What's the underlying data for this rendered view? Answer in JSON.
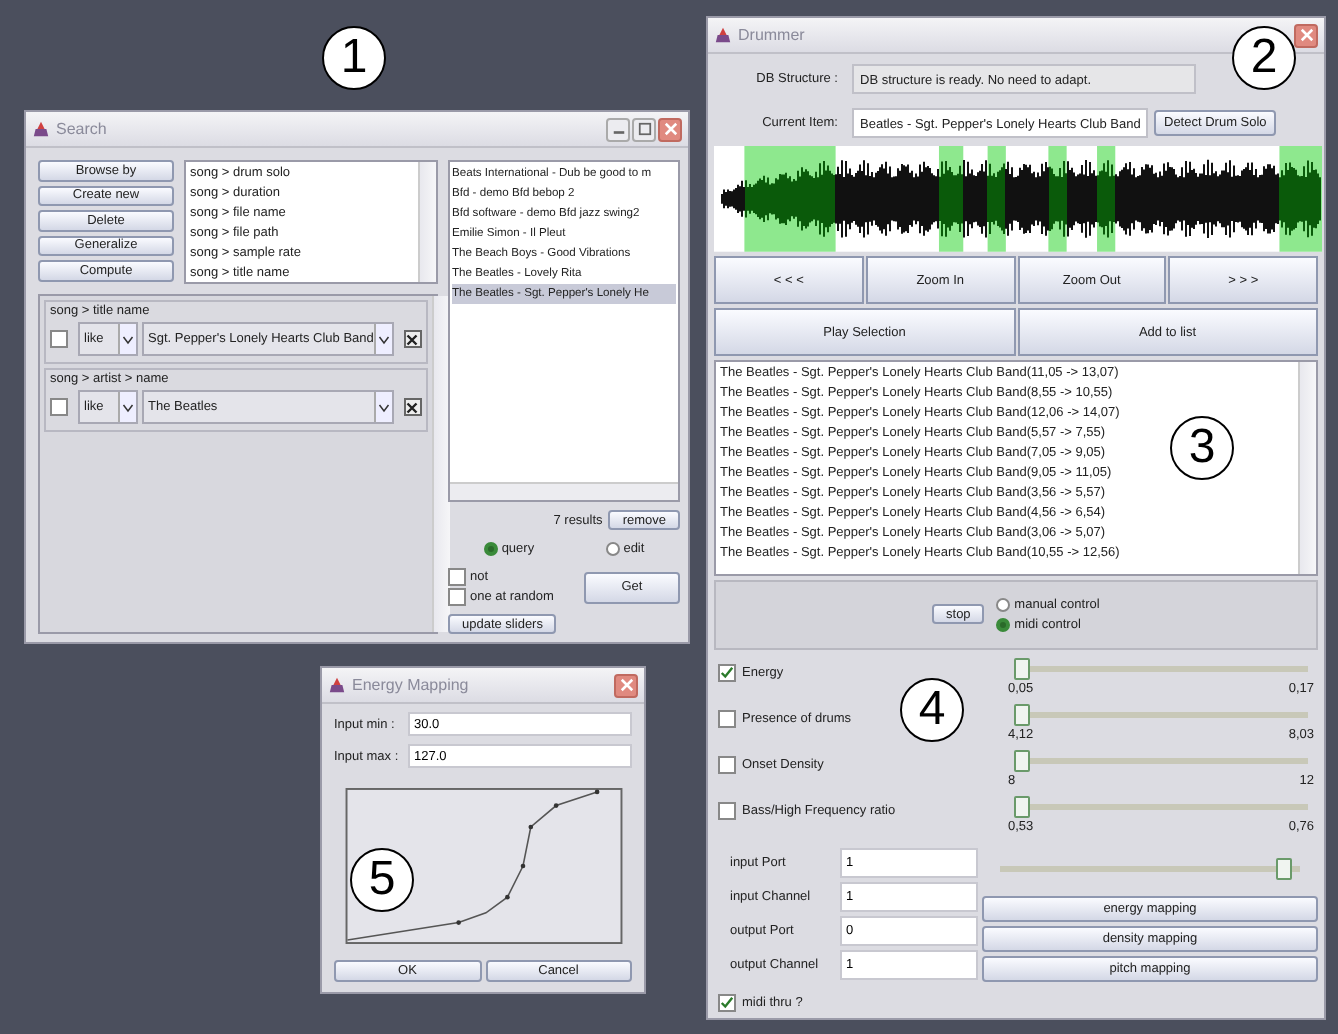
{
  "search_window": {
    "title": "Search",
    "buttons": [
      "Browse by",
      "Create new",
      "Delete",
      "Generalize",
      "Compute"
    ],
    "attributes": [
      "song > drum solo",
      "song > duration",
      "song > file name",
      "song > file path",
      "song > sample rate",
      "song > title name"
    ],
    "criteria": [
      {
        "path": "song > title name",
        "checked": false,
        "operator": "like",
        "value": "Sgt. Pepper's Lonely Hearts Club Band"
      },
      {
        "path": "song > artist > name",
        "checked": false,
        "operator": "like",
        "value": "The Beatles"
      }
    ],
    "results": [
      {
        "text": "Beats International - Dub be good to m",
        "selected": false
      },
      {
        "text": "Bfd - demo Bfd bebop 2",
        "selected": false
      },
      {
        "text": "Bfd software - demo Bfd jazz swing2",
        "selected": false
      },
      {
        "text": "Emilie Simon - Il Pleut",
        "selected": false
      },
      {
        "text": "The Beach Boys - Good Vibrations",
        "selected": false
      },
      {
        "text": "The Beatles - Lovely Rita",
        "selected": false
      },
      {
        "text": "The Beatles - Sgt. Pepper's Lonely He",
        "selected": true
      }
    ],
    "result_count": "7 results",
    "remove_button": "remove",
    "modes": [
      {
        "label": "query",
        "selected": true
      },
      {
        "label": "edit",
        "selected": false
      }
    ],
    "options": [
      {
        "label": "not",
        "checked": false
      },
      {
        "label": "one at random",
        "checked": false
      }
    ],
    "get_button": "Get",
    "update_button": "update sliders"
  },
  "drummer_window": {
    "title": "Drummer",
    "db_structure": {
      "label": "DB Structure :",
      "value": "DB structure is ready. No need to adapt."
    },
    "current_item": {
      "label": "Current Item:",
      "value": "Beatles - Sgt. Pepper's Lonely Hearts Club Band"
    },
    "detect_button": "Detect Drum Solo",
    "nav_buttons": [
      "< < <",
      "Zoom In",
      "Zoom Out",
      "> > >"
    ],
    "action_buttons": [
      "Play Selection",
      "Add to list"
    ],
    "segments": [
      "The Beatles - Sgt. Pepper's Lonely Hearts Club Band(11,05 -> 13,07)",
      "The Beatles - Sgt. Pepper's Lonely Hearts Club Band(8,55 -> 10,55)",
      "The Beatles - Sgt. Pepper's Lonely Hearts Club Band(12,06 -> 14,07)",
      "The Beatles - Sgt. Pepper's Lonely Hearts Club Band(5,57 -> 7,55)",
      "The Beatles - Sgt. Pepper's Lonely Hearts Club Band(7,05 -> 9,05)",
      "The Beatles - Sgt. Pepper's Lonely Hearts Club Band(9,05 -> 11,05)",
      "The Beatles - Sgt. Pepper's Lonely Hearts Club Band(3,56 -> 5,57)",
      "The Beatles - Sgt. Pepper's Lonely Hearts Club Band(4,56 -> 6,54)",
      "The Beatles - Sgt. Pepper's Lonely Hearts Club Band(3,06 -> 5,07)",
      "The Beatles - Sgt. Pepper's Lonely Hearts Club Band(10,55 -> 12,56)"
    ],
    "stop_button": "stop",
    "control_modes": [
      {
        "label": "manual control",
        "selected": false
      },
      {
        "label": "midi control",
        "selected": true
      }
    ],
    "features": [
      {
        "label": "Energy",
        "checked": true,
        "level": 0,
        "min": "0,05",
        "max": "0,17"
      },
      {
        "label": "Presence of drums",
        "checked": false,
        "level": 0,
        "min": "4,12",
        "max": "8,03"
      },
      {
        "label": "Onset Density",
        "checked": false,
        "level": 0,
        "min": "8",
        "max": "12"
      },
      {
        "label": "Bass/High Frequency ratio",
        "checked": false,
        "level": 0,
        "min": "0,53",
        "max": "0,76"
      }
    ],
    "adaptivity_slider": {
      "level": 0.97
    },
    "ports": [
      {
        "label": "input Port",
        "value": "1"
      },
      {
        "label": "input Channel",
        "value": "1"
      },
      {
        "label": "output Port",
        "value": "0"
      },
      {
        "label": "output Channel",
        "value": "1"
      }
    ],
    "mapping_buttons": [
      "energy mapping",
      "density mapping",
      "pitch mapping"
    ],
    "midi_thru": {
      "label": "midi thru ?",
      "checked": true
    }
  },
  "energy_window": {
    "title": "Energy Mapping",
    "fields": [
      {
        "label": "Input min :",
        "value": "30.0"
      },
      {
        "label": "Input max :",
        "value": "127.0"
      }
    ],
    "buttons": [
      "OK",
      "Cancel"
    ]
  },
  "callouts": [
    "1",
    "2",
    "3",
    "4",
    "5"
  ]
}
